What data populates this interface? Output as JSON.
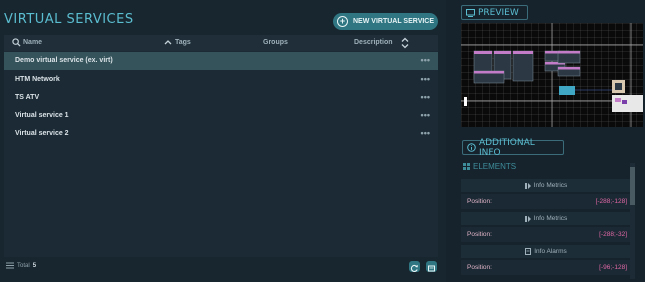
{
  "page": {
    "title": "VIRTUAL SERVICES",
    "new_button_label": "NEW VIRTUAL SERVICE"
  },
  "table": {
    "columns": {
      "name": "Name",
      "tags": "Tags",
      "groups": "Groups",
      "description": "Description"
    },
    "rows": [
      {
        "name": "Demo virtual service (ex. virt)",
        "selected": true
      },
      {
        "name": "HTM Network",
        "selected": false
      },
      {
        "name": "TS ATV",
        "selected": false
      },
      {
        "name": "Virtual service 1",
        "selected": false
      },
      {
        "name": "Virtual service 2",
        "selected": false
      }
    ],
    "row_menu": "•••",
    "total_label": "Total",
    "total_value": "5"
  },
  "right": {
    "preview_title": "PREVIEW",
    "additional_info_title": "ADDITIONAL INFO",
    "elements_title": "ELEMENTS",
    "items": [
      {
        "type": "Info Metrics",
        "position_label": "Position:",
        "position_value": "[-288;-128]"
      },
      {
        "type": "Info Metrics",
        "position_label": "Position:",
        "position_value": "[-288;-32]"
      },
      {
        "type": "Info Alarms",
        "position_label": "Position:",
        "position_value": "[-96;-128]"
      }
    ]
  },
  "colors": {
    "accent": "#5bbdd0",
    "button": "#2f7682",
    "selected_row": "#34535a",
    "position_value": "#e268a7"
  },
  "icons": [
    "search-icon",
    "sort-up-icon",
    "sort-icon",
    "plus-circle-icon",
    "refresh-icon",
    "export-icon",
    "list-icon",
    "monitor-icon",
    "info-icon",
    "grid-icon",
    "metrics-icon",
    "alarm-icon"
  ]
}
